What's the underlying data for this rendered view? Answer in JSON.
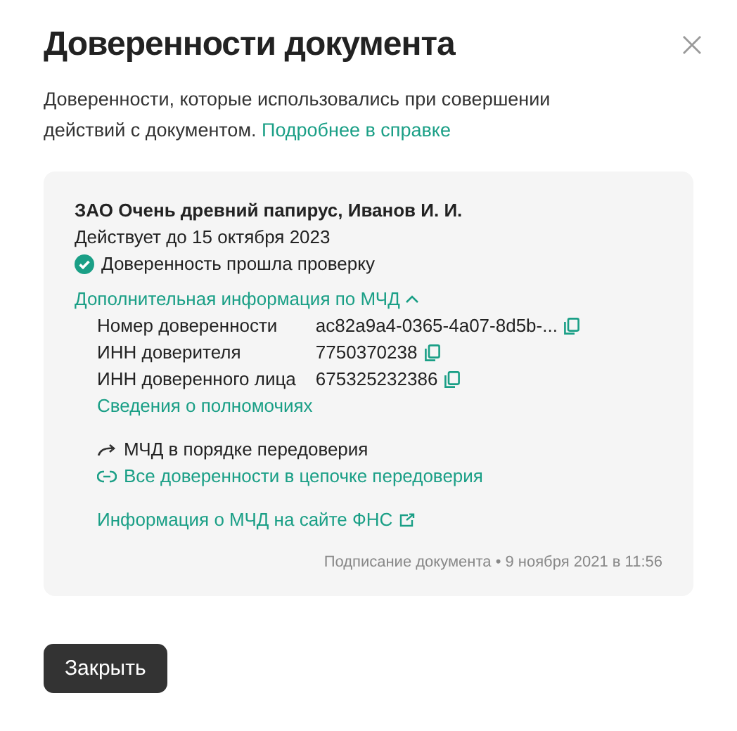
{
  "dialog": {
    "title": "Доверенности документа",
    "description": "Доверенности, которые использовались при совершении действий с документом.",
    "help_link": "Подробнее в справке"
  },
  "card": {
    "principal": "ЗАО Очень древний папирус, Иванов И. И.",
    "valid_until": "Действует до 15 октября 2023",
    "verified": true,
    "verification": "Доверенность прошла проверку",
    "extra_info": {
      "label": "Дополнительная информация по МЧД",
      "expanded": true,
      "fields": [
        {
          "label": "Номер доверенности",
          "value": "ac82a9a4-0365-4a07-8d5b-..."
        },
        {
          "label": "ИНН доверителя",
          "value": "7750370238"
        },
        {
          "label": "ИНН доверенного лица",
          "value": "675325232386"
        }
      ],
      "powers_link": "Сведения о полномочиях"
    },
    "redelegation": "МЧД в порядке передоверия",
    "chain_link": "Все доверенности в цепочке передоверия",
    "fns_link": "Информация о МЧД на сайте ФНС",
    "footer": "Подписание документа • 9 ноября 2021 в 11:56"
  },
  "buttons": [
    {
      "label": "Закрыть"
    }
  ]
}
